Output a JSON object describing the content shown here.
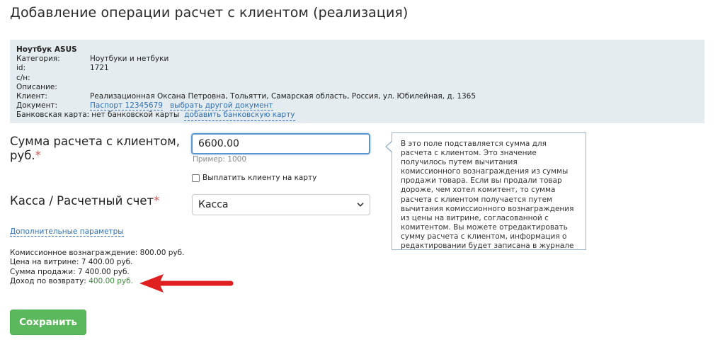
{
  "page": {
    "title": "Добавление операции расчет с клиентом (реализация)"
  },
  "product": {
    "name": "Ноутбук ASUS",
    "rows": [
      {
        "label": "Категория:",
        "value": "Ноутбуки и нетбуки"
      },
      {
        "label": "id:",
        "value": "1721"
      },
      {
        "label": "с/н:",
        "value": ""
      },
      {
        "label": "Описание:",
        "value": ""
      },
      {
        "label": "Клиент:",
        "value": "Реализационная Оксана Петровна, Тольятти, Самарская область, Россия, ул. Юбилейная, д. 1365"
      }
    ],
    "document": {
      "label": "Документ:",
      "link": "Паспорт 12345679",
      "change_link": "выбрать другой документ"
    },
    "bank_card": {
      "label": "Банковская карта:",
      "value": "нет банковской карты",
      "add_link": "добавить банковскую карту"
    }
  },
  "amount": {
    "label": "Сумма расчета с клиентом, руб.",
    "required_mark": "*",
    "value": "6600.00",
    "example": "Пример: 1000"
  },
  "card_checkbox": {
    "label": "Выплатить клиенту на карту",
    "checked": false
  },
  "cashbox": {
    "label": "Касса / Расчетный счет",
    "required_mark": "*",
    "selected": "Касса"
  },
  "tooltip": {
    "text": "В это поле подставляется сумма для расчета с клиентом. Это значение получилось путем вычитания комиссионного вознаграждения из суммы продажи товара. Если вы продали товар дороже, чем хотел комитент, то сумма расчета с клиентом получается путем вычитания комиссионного вознаграждения из цены на витрине, согласованной с комитентом. Вы можете отредактировать сумму расчета с клиентом, информация о редактировании будет записана в журнале"
  },
  "extra_params_link": "Дополнительные параметры",
  "summary": {
    "commission": "Комиссионное вознаграждение: 800.00 руб.",
    "showcase_price": "Цена на витрине: 7 400.00 руб.",
    "sale_amount": "Сумма продажи: 7 400.00 руб.",
    "return_income_label": "Доход по возврату:",
    "return_income_value": "400.00 руб."
  },
  "save_button": "Сохранить",
  "colors": {
    "accent": "#2f6fb5",
    "success": "#5cb85c",
    "arrow": "#e02020",
    "panel": "#e4ecef"
  },
  "icons": {
    "select": "chevron-down-icon",
    "pointer": "red-arrow-icon"
  }
}
